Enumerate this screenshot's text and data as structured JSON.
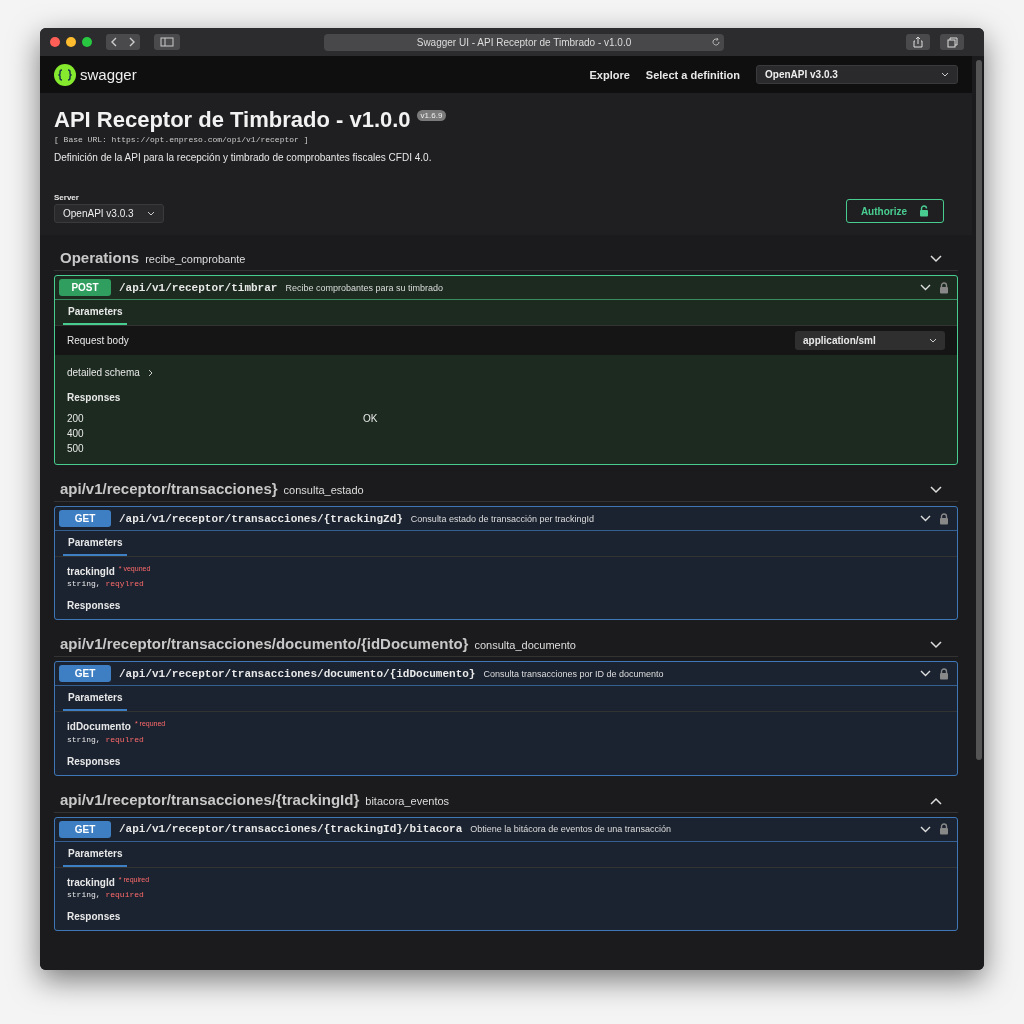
{
  "browser": {
    "title": "Swagger UI - API Receptor de Timbrado - v1.0.0"
  },
  "topbar": {
    "logo": "swagger",
    "explore": "Explore",
    "definition_label": "Select a definition",
    "definition": "OpenAPI v3.0.3"
  },
  "info": {
    "title": "API Receptor de Timbrado - v1.0.0",
    "version": "v1.6.9",
    "base_url": "[ Base URL: https://opt.enpreso.com/opi/v1/receptor ]",
    "description": "Definición de la API para la recepción y timbrado de comprobantes fiscales CFDI 4.0.",
    "server_label": "Server",
    "server": "OpenAPI v3.0.3",
    "authorize": "Authorize"
  },
  "sections": [
    {
      "title": "Operations",
      "subtitle": "recibe_comprobante",
      "expanded": false,
      "operation": {
        "method": "POST",
        "kind": "post",
        "path": "/api/v1/receptor/timbrar",
        "summary": "Recibe comprobantes para su timbrado",
        "tab": "Parameters",
        "request_body": "Request body",
        "content_type": "application/sml",
        "schema_link": "detailed schema",
        "responses_label": "Responses",
        "responses": [
          {
            "code": "200",
            "description": "OK"
          },
          {
            "code": "400"
          },
          {
            "code": "500"
          }
        ]
      }
    },
    {
      "title": "api/v1/receptor/transacciones}",
      "subtitle": "consulta_estado",
      "expanded": false,
      "operation": {
        "method": "GET",
        "kind": "get",
        "path": "/api/v1/receptor/transacciones/{trackingZd}",
        "summary": "Consulta estado de transacción per trackingId",
        "tab": "Parameters",
        "param": {
          "name": "trackingId",
          "required": "* vequned",
          "type": "string,",
          "type_note": "reqylred"
        },
        "responses_label": "Responses"
      }
    },
    {
      "title": "api/v1/receptor/transacciones/documento/{idDocumento}",
      "subtitle": "consulta_documento",
      "expanded": false,
      "operation": {
        "method": "GET",
        "kind": "get",
        "path": "/api/v1/receptor/transacciones/documento/{idDocumento}",
        "summary": "Consulta transacciones por ID de documento",
        "tab": "Parameters",
        "param": {
          "name": "idDocumento",
          "required": "* requned",
          "type": "string,",
          "type_note": "requlred"
        },
        "responses_label": "Responses"
      }
    },
    {
      "title": "api/v1/receptor/transacciones/{trackingId}",
      "subtitle": "bitacora_eventos",
      "expanded": true,
      "operation": {
        "method": "GET",
        "kind": "get",
        "path": "/api/v1/receptor/transacciones/{trackingId}/bitacora",
        "summary": "Obtiene la bitácora de eventos de una transacción",
        "tab": "Parameters",
        "param": {
          "name": "trackingId",
          "required": "* required",
          "type": "string,",
          "type_note": "required"
        },
        "responses_label": "Responses"
      }
    }
  ]
}
